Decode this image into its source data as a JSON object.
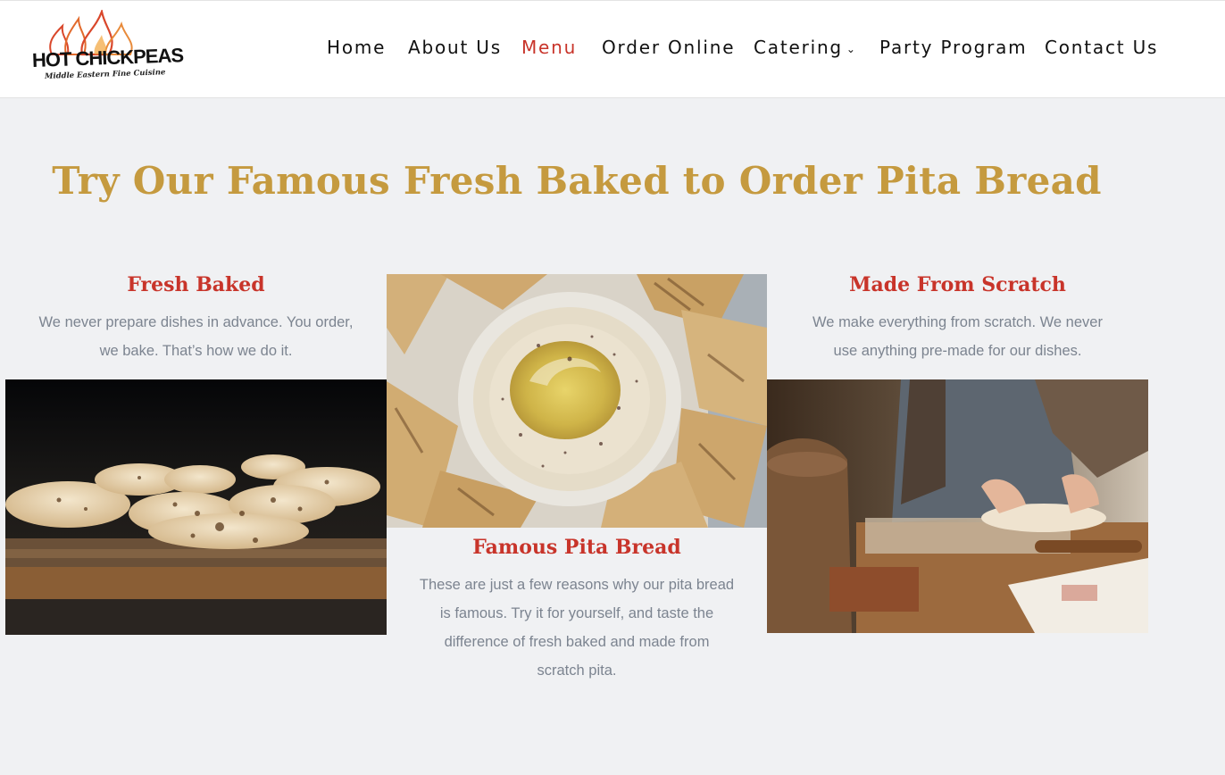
{
  "brand": {
    "name": "HOT CHICKPEAS",
    "tagline": "Middle Eastern Fine Cuisine"
  },
  "nav": {
    "items": [
      "Home",
      "About Us",
      "Menu",
      "Order Online",
      "Catering",
      "Party Program",
      "Contact Us"
    ],
    "active": "Menu",
    "catering_dropdown_icon": "chevron-down-icon"
  },
  "main": {
    "headline": "Try Our Famous Fresh Baked to Order Pita Bread",
    "features": [
      {
        "title": "Fresh Baked",
        "text_lines": [
          "We never prepare dishes in advance. You order,",
          "we bake. That’s how we do it."
        ]
      },
      {
        "title": "Famous Pita Bread",
        "text_lines": [
          "These are just a few reasons why our pita bread",
          "is famous. Try it for yourself, and taste the",
          "difference of fresh baked and made from",
          "scratch pita."
        ]
      },
      {
        "title": "Made From Scratch",
        "text_lines": [
          "We make everything from scratch. We never",
          "use anything pre-made for our dishes."
        ]
      }
    ]
  },
  "colors": {
    "accent_red": "#c8342a",
    "headline_gold": "#c59a3f",
    "body_gray": "#7c8490",
    "page_bg": "#f0f1f3"
  }
}
